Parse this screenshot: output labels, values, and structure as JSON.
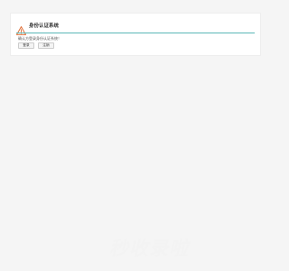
{
  "dialog": {
    "title": "身份认证系统",
    "message": "确认方登录身份认证系统！",
    "buttons": {
      "confirm_label": "登录",
      "cancel_label": "注销"
    },
    "accent_color": "#5bb8b8",
    "icon": "warning-icon"
  },
  "watermark": {
    "text": "秒收录啦"
  }
}
